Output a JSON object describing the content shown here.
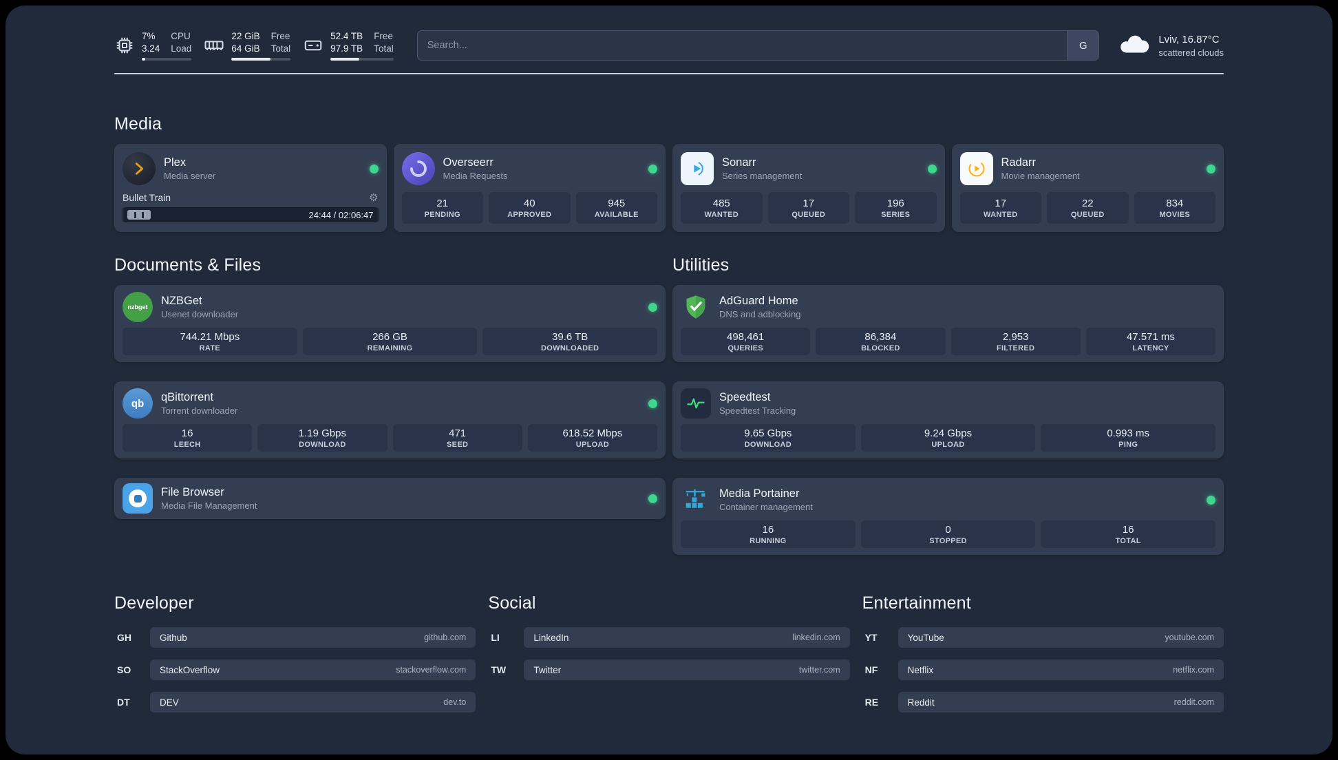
{
  "topbar": {
    "cpu": {
      "percent": "7%",
      "load": "3.24",
      "label_top": "CPU",
      "label_bottom": "Load"
    },
    "memory": {
      "free": "22 GiB",
      "total": "64 GiB",
      "label_top": "Free",
      "label_bottom": "Total"
    },
    "disk": {
      "free": "52.4 TB",
      "total": "97.9 TB",
      "label_top": "Free",
      "label_bottom": "Total"
    },
    "search": {
      "placeholder": "Search...",
      "provider": "G"
    },
    "weather": {
      "location": "Lviv, 16.87°C",
      "condition": "scattered clouds"
    }
  },
  "media": {
    "title": "Media",
    "plex": {
      "name": "Plex",
      "subtitle": "Media server",
      "player": {
        "title": "Bullet Train",
        "time": "24:44 / 02:06:47"
      }
    },
    "overseerr": {
      "name": "Overseerr",
      "subtitle": "Media Requests",
      "stats": [
        {
          "value": "21",
          "label": "PENDING"
        },
        {
          "value": "40",
          "label": "APPROVED"
        },
        {
          "value": "945",
          "label": "AVAILABLE"
        }
      ]
    },
    "sonarr": {
      "name": "Sonarr",
      "subtitle": "Series management",
      "stats": [
        {
          "value": "485",
          "label": "WANTED"
        },
        {
          "value": "17",
          "label": "QUEUED"
        },
        {
          "value": "196",
          "label": "SERIES"
        }
      ]
    },
    "radarr": {
      "name": "Radarr",
      "subtitle": "Movie management",
      "stats": [
        {
          "value": "17",
          "label": "WANTED"
        },
        {
          "value": "22",
          "label": "QUEUED"
        },
        {
          "value": "834",
          "label": "MOVIES"
        }
      ]
    }
  },
  "documents": {
    "title": "Documents & Files",
    "nzbget": {
      "name": "NZBGet",
      "subtitle": "Usenet downloader",
      "icon_text": "nzbget",
      "stats": [
        {
          "value": "744.21 Mbps",
          "label": "RATE"
        },
        {
          "value": "266 GB",
          "label": "REMAINING"
        },
        {
          "value": "39.6 TB",
          "label": "DOWNLOADED"
        }
      ]
    },
    "qbittorrent": {
      "name": "qBittorrent",
      "subtitle": "Torrent downloader",
      "icon_text": "qb",
      "stats": [
        {
          "value": "16",
          "label": "LEECH"
        },
        {
          "value": "1.19 Gbps",
          "label": "DOWNLOAD"
        },
        {
          "value": "471",
          "label": "SEED"
        },
        {
          "value": "618.52 Mbps",
          "label": "UPLOAD"
        }
      ]
    },
    "filebrowser": {
      "name": "File Browser",
      "subtitle": "Media File Management"
    }
  },
  "utilities": {
    "title": "Utilities",
    "adguard": {
      "name": "AdGuard Home",
      "subtitle": "DNS and adblocking",
      "stats": [
        {
          "value": "498,461",
          "label": "QUERIES"
        },
        {
          "value": "86,384",
          "label": "BLOCKED"
        },
        {
          "value": "2,953",
          "label": "FILTERED"
        },
        {
          "value": "47.571 ms",
          "label": "LATENCY"
        }
      ]
    },
    "speedtest": {
      "name": "Speedtest",
      "subtitle": "Speedtest Tracking",
      "stats": [
        {
          "value": "9.65 Gbps",
          "label": "DOWNLOAD"
        },
        {
          "value": "9.24 Gbps",
          "label": "UPLOAD"
        },
        {
          "value": "0.993 ms",
          "label": "PING"
        }
      ]
    },
    "portainer": {
      "name": "Media Portainer",
      "subtitle": "Container management",
      "stats": [
        {
          "value": "16",
          "label": "RUNNING"
        },
        {
          "value": "0",
          "label": "STOPPED"
        },
        {
          "value": "16",
          "label": "TOTAL"
        }
      ]
    }
  },
  "bookmarks": {
    "developer": {
      "title": "Developer",
      "items": [
        {
          "abbr": "GH",
          "name": "Github",
          "url": "github.com"
        },
        {
          "abbr": "SO",
          "name": "StackOverflow",
          "url": "stackoverflow.com"
        },
        {
          "abbr": "DT",
          "name": "DEV",
          "url": "dev.to"
        }
      ]
    },
    "social": {
      "title": "Social",
      "items": [
        {
          "abbr": "LI",
          "name": "LinkedIn",
          "url": "linkedin.com"
        },
        {
          "abbr": "TW",
          "name": "Twitter",
          "url": "twitter.com"
        }
      ]
    },
    "entertainment": {
      "title": "Entertainment",
      "items": [
        {
          "abbr": "YT",
          "name": "YouTube",
          "url": "youtube.com"
        },
        {
          "abbr": "NF",
          "name": "Netflix",
          "url": "netflix.com"
        },
        {
          "abbr": "RE",
          "name": "Reddit",
          "url": "reddit.com"
        }
      ]
    }
  },
  "colors": {
    "status_online": "#3dd68c",
    "background": "#212a3a",
    "card": "#343e52",
    "plex_accent": "#e5a00d"
  }
}
